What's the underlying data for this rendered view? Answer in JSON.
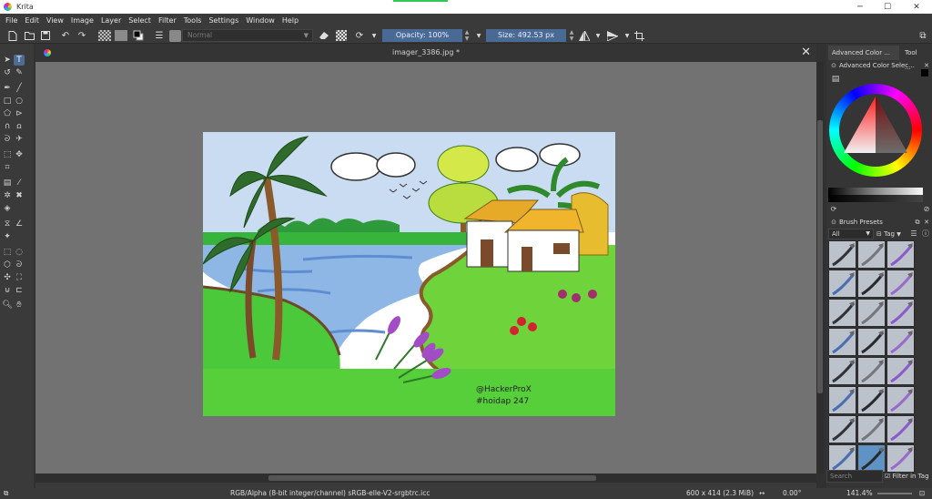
{
  "window": {
    "app_title": "Krita",
    "minimize_glyph": "─",
    "maximize_glyph": "☐",
    "close_glyph": "✕"
  },
  "menu": [
    "File",
    "Edit",
    "View",
    "Image",
    "Layer",
    "Select",
    "Filter",
    "Tools",
    "Settings",
    "Window",
    "Help"
  ],
  "toolbar": {
    "blend_mode": "Normal",
    "opacity_label": "Opacity: 100%",
    "size_label": "Size: 492.53 px"
  },
  "document": {
    "title": "imager_3386.jpg *",
    "close_glyph": "✕"
  },
  "image": {
    "watermark_line1": "@HackerProX",
    "watermark_line2": "#hoidap 247"
  },
  "dock": {
    "tab_color": "Advanced Color ...",
    "tab_tool": "Tool ...",
    "color_selector_title": "Advanced Color Selec...",
    "brush_presets_title": "Brush Presets",
    "tag_filter": "All",
    "tag_label": "Tag",
    "search_placeholder": "Search",
    "filter_in_tag": "Filter in Tag"
  },
  "status": {
    "color_profile": "RGB/Alpha (8-bit integer/channel)  sRGB-elle-V2-srgbtrc.icc",
    "image_size": "600 x 414 (2.3 MiB)",
    "rotation": "0.00°",
    "zoom": "141.4%"
  },
  "colors": {
    "accent": "#496a95",
    "canvas_bg": "#727272",
    "panel_bg": "#3a3a3a"
  }
}
